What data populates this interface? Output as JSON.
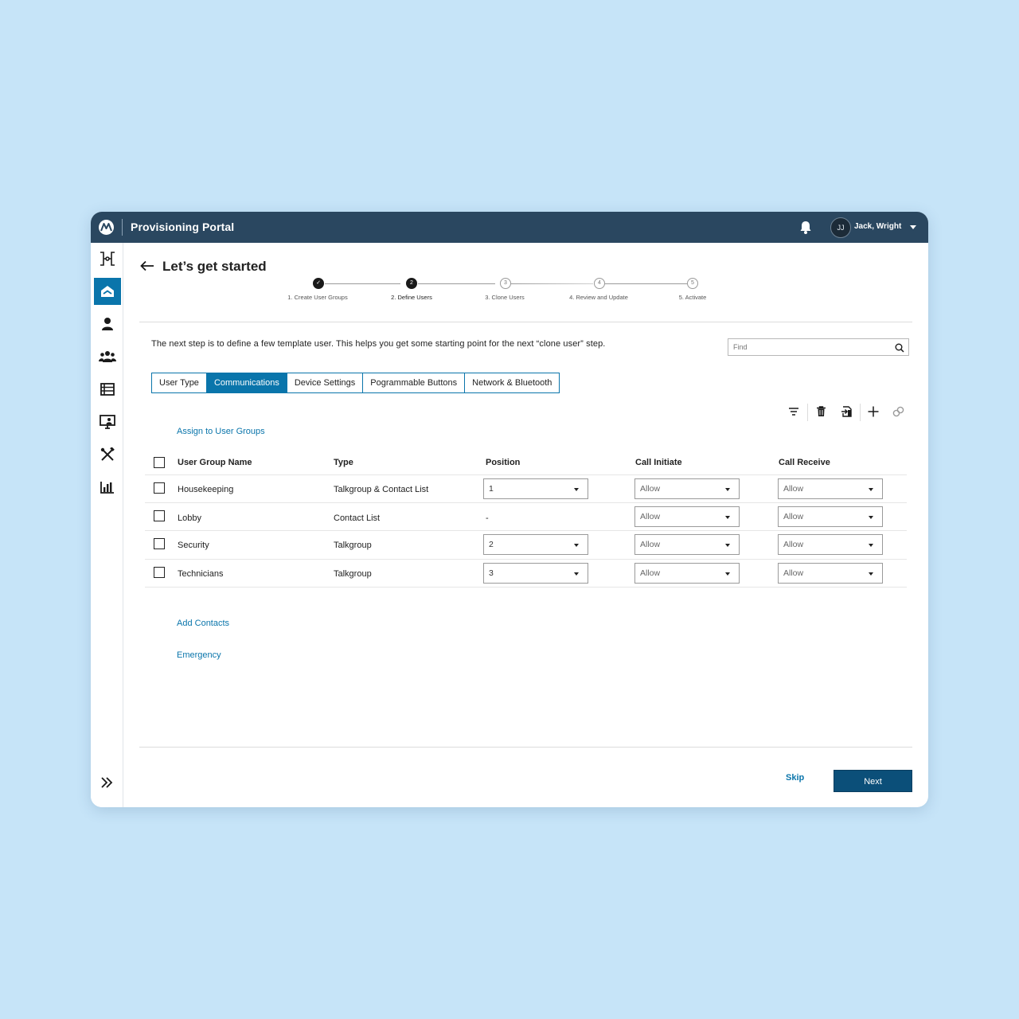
{
  "header": {
    "app_title": "Provisioning Portal",
    "user_initials": "JJ",
    "user_name": "Jack, Wright"
  },
  "sidebar": {
    "items": [
      {
        "icon": "org-chart-icon"
      },
      {
        "icon": "home-icon",
        "active": true
      },
      {
        "icon": "user-icon"
      },
      {
        "icon": "group-icon"
      },
      {
        "icon": "list-icon"
      },
      {
        "icon": "monitor-user-icon"
      },
      {
        "icon": "tools-icon"
      },
      {
        "icon": "bar-chart-icon"
      }
    ],
    "expand_icon": "double-chevron-right-icon"
  },
  "page": {
    "title": "Let’s get started",
    "intro": "The next step is to define a few template user. This helps you get some starting point for the next “clone user” step.",
    "find_placeholder": "Find"
  },
  "stepper": {
    "steps": [
      {
        "number": "✓",
        "label": "1. Create User Groups",
        "state": "done"
      },
      {
        "number": "2",
        "label": "2. Define Users",
        "state": "current"
      },
      {
        "number": "3",
        "label": "3. Clone Users",
        "state": "todo"
      },
      {
        "number": "4",
        "label": "4. Review and Update",
        "state": "todo"
      },
      {
        "number": "5",
        "label": "5. Activate",
        "state": "todo"
      }
    ]
  },
  "tabs": [
    {
      "label": "User Type",
      "active": false
    },
    {
      "label": "Communications",
      "active": true
    },
    {
      "label": "Device Settings",
      "active": false
    },
    {
      "label": "Pogrammable Buttons",
      "active": false
    },
    {
      "label": "Network & Bluetooth",
      "active": false
    }
  ],
  "toolbar": {
    "icons": [
      "filter-icon",
      "trash-icon",
      "import-icon",
      "plus-icon",
      "link-icon"
    ]
  },
  "sections": {
    "assign": "Assign to User Groups",
    "add_contacts": "Add Contacts",
    "emergency": "Emergency"
  },
  "table": {
    "headers": {
      "name": "User Group Name",
      "type": "Type",
      "position": "Position",
      "call_initiate": "Call Initiate",
      "call_receive": "Call Receive"
    },
    "rows": [
      {
        "name": "Housekeeping",
        "type": "Talkgroup & Contact List",
        "position": "1",
        "call_initiate": "Allow",
        "call_receive": "Allow"
      },
      {
        "name": "Lobby",
        "type": "Contact List",
        "position": "-",
        "call_initiate": "Allow",
        "call_receive": "Allow"
      },
      {
        "name": "Security",
        "type": "Talkgroup",
        "position": "2",
        "call_initiate": "Allow",
        "call_receive": "Allow"
      },
      {
        "name": "Technicians",
        "type": "Talkgroup",
        "position": "3",
        "call_initiate": "Allow",
        "call_receive": "Allow"
      }
    ]
  },
  "footer": {
    "skip_label": "Skip",
    "next_label": "Next"
  },
  "colors": {
    "topbar": "#2a4760",
    "accent": "#0a75ab",
    "next_button": "#0b4f79",
    "background": "#c6e4f8"
  }
}
